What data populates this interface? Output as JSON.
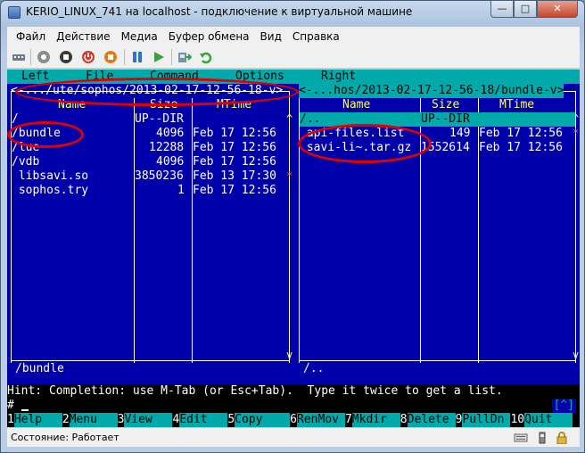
{
  "window": {
    "title": "KERIO_LINUX_741 на localhost - подключение к виртуальной машине",
    "min": "—",
    "max": "□",
    "close": "✕"
  },
  "menubar": [
    "Файл",
    "Действие",
    "Медиа",
    "Буфер обмена",
    "Вид",
    "Справка"
  ],
  "toolbar": {
    "icons": [
      "ctrl-alt-del-icon",
      "start-icon",
      "turn-off-icon",
      "shutdown-icon",
      "save-icon",
      "pause-icon",
      "play-icon",
      "snapshot-icon",
      "revert-icon"
    ]
  },
  "mc": {
    "topmenu": [
      "Left",
      "File",
      "Command",
      "Options",
      "Right"
    ],
    "left": {
      "title": "<-.../ute/sophos/2013-02-17-12-56-18-v>",
      "col_name": "Name",
      "col_size": "Size",
      "col_mtime": "MTime",
      "rows": [
        {
          "name": "/",
          "size": "UP--DIR",
          "mtime": ""
        },
        {
          "name": "/bundle",
          "size": "4096",
          "mtime": "Feb 17 12:56"
        },
        {
          "name": "/lue",
          "size": "12288",
          "mtime": "Feb 17 12:56"
        },
        {
          "name": "/vdb",
          "size": "4096",
          "mtime": "Feb 17 12:56"
        },
        {
          "name": " libsavi.so",
          "size": "3850236",
          "mtime": "Feb 13 17:30"
        },
        {
          "name": " sophos.try",
          "size": "1",
          "mtime": "Feb 17 12:56"
        }
      ],
      "minibar": "/bundle"
    },
    "right": {
      "title": "<-...hos/2013-02-17-12-56-18/bundle-v>",
      "col_name": "Name",
      "col_size": "Size",
      "col_mtime": "MTime",
      "rows": [
        {
          "name": "/..",
          "size": "UP--DIR",
          "mtime": ""
        },
        {
          "name": " api-files.list",
          "size": "149",
          "mtime": "Feb 17 12:56"
        },
        {
          "name": " savi-li~.tar.gz",
          "size": "1552614",
          "mtime": "Feb 17 12:56"
        }
      ],
      "minibar": "/.."
    },
    "hint": "Hint: Completion: use M-Tab (or Esc+Tab).  Type it twice to get a list.",
    "prompt": "#",
    "prompt_bracket": "[^]",
    "fkeys": [
      {
        "num": "1",
        "label": "Help"
      },
      {
        "num": "2",
        "label": "Menu"
      },
      {
        "num": "3",
        "label": "View"
      },
      {
        "num": "4",
        "label": "Edit"
      },
      {
        "num": "5",
        "label": "Copy"
      },
      {
        "num": "6",
        "label": "RenMov"
      },
      {
        "num": "7",
        "label": "Mkdir"
      },
      {
        "num": "8",
        "label": "Delete"
      },
      {
        "num": "9",
        "label": "PullDn"
      },
      {
        "num": "10",
        "label": "Quit"
      }
    ]
  },
  "status": {
    "text": "Состояние: Работает"
  },
  "colors": {
    "console_bg": "#0000aa",
    "cyan": "#00aaaa",
    "header_yellow": "#ffff55",
    "annotation_red": "#e00000"
  }
}
